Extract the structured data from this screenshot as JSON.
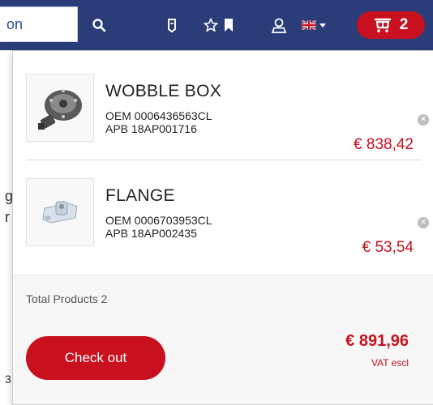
{
  "header": {
    "search": {
      "value": "on"
    },
    "icons": [
      "search-icon",
      "shield-icon",
      "star-icon",
      "bookmark-icon",
      "user-icon"
    ],
    "language": {
      "flag": "uk-flag-icon"
    },
    "cart": {
      "count": "2"
    }
  },
  "background_fragments": [
    "g",
    "r",
    "3"
  ],
  "cart_panel": {
    "items": [
      {
        "name": "WOBBLE BOX",
        "oem": "OEM 0006436563CL",
        "apb": "APB 18AP001716",
        "price": "€ 838,42"
      },
      {
        "name": "FLANGE",
        "oem": "OEM 0006703953CL",
        "apb": "APB 18AP002435",
        "price": "€ 53,54"
      }
    ],
    "total_products": "Total Products 2",
    "checkout_label": "Check out",
    "grand_total": "€ 891,96",
    "vat_note": "VAT escl"
  },
  "colors": {
    "header_bg": "#2a3d78",
    "accent": "#c8101e"
  }
}
